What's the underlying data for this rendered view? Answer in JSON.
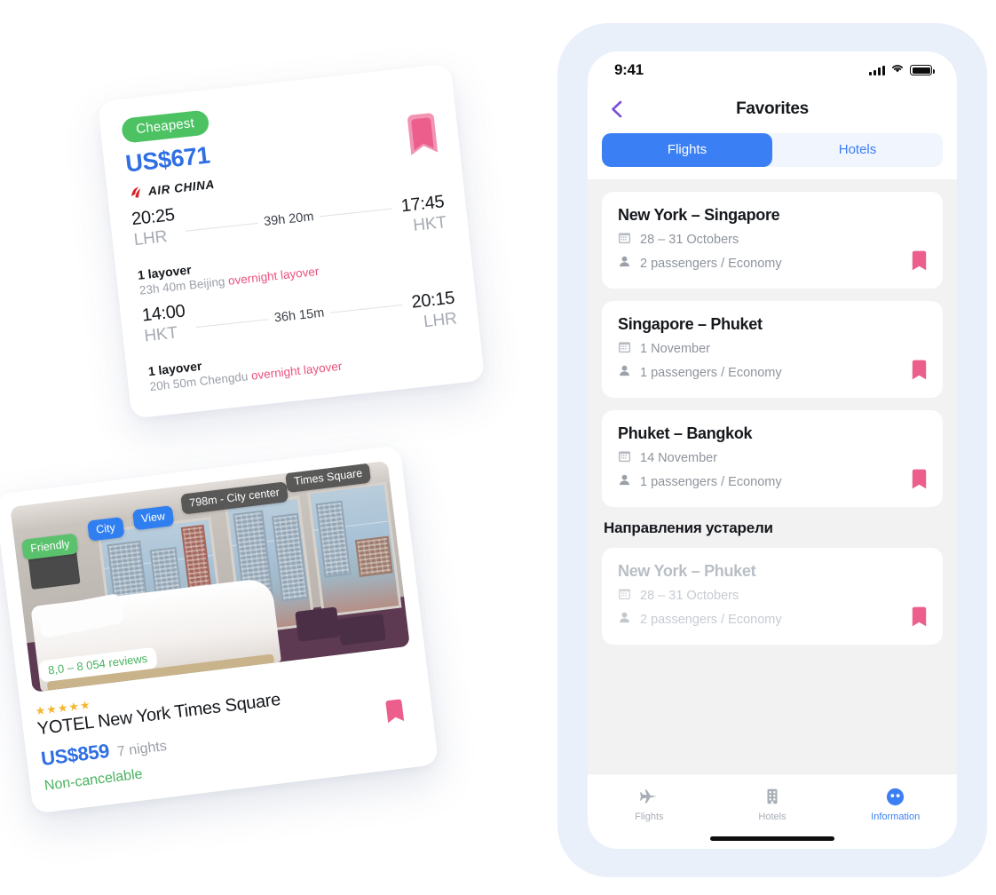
{
  "flight_card": {
    "badge": "Cheapest",
    "price": "US$671",
    "airline": "AIR CHINA",
    "legs": [
      {
        "depart_time": "20:25",
        "depart_code": "LHR",
        "duration": "39h 20m",
        "arrive_time": "17:45",
        "arrive_code": "HKT",
        "stops": "1 layover",
        "layover_detail": "23h 40m Beijing",
        "layover_note": "overnight layover"
      },
      {
        "depart_time": "14:00",
        "depart_code": "HKT",
        "duration": "36h 15m",
        "arrive_time": "20:15",
        "arrive_code": "LHR",
        "stops": "1 layover",
        "layover_detail": "20h 50m Chengdu",
        "layover_note": "overnight layover"
      }
    ]
  },
  "hotel_card": {
    "tags": [
      {
        "label": "Friendly",
        "style": "green"
      },
      {
        "label": "City",
        "style": "blue"
      },
      {
        "label": "View",
        "style": "blue"
      },
      {
        "label": "798m - City center",
        "style": "dark"
      },
      {
        "label": "Times Square",
        "style": "dark"
      }
    ],
    "reviews": "8,0 – 8 054 reviews",
    "stars": "★★★★★",
    "name": "YOTEL New York Times Square",
    "price": "US$859",
    "nights": "7 nights",
    "cancel_policy": "Non-cancelable"
  },
  "phone": {
    "status_bar": {
      "time": "9:41"
    },
    "title": "Favorites",
    "segmented": {
      "options": [
        {
          "label": "Flights",
          "active": true
        },
        {
          "label": "Hotels",
          "active": false
        }
      ]
    },
    "favorites": [
      {
        "route": "New York – Singapore",
        "dates": "28 – 31 Octobers",
        "passengers": "2 passengers / Economy"
      },
      {
        "route": "Singapore – Phuket",
        "dates": "1 November",
        "passengers": "1 passengers / Economy"
      },
      {
        "route": "Phuket – Bangkok",
        "dates": "14 November",
        "passengers": "1 passengers / Economy"
      }
    ],
    "expired_section": {
      "heading": "Направления устарели",
      "items": [
        {
          "route": "New York – Phuket",
          "dates": "28 – 31 Octobers",
          "passengers": "2 passengers / Economy"
        }
      ]
    },
    "tabbar": [
      {
        "label": "Flights",
        "icon": "plane-icon",
        "active": false
      },
      {
        "label": "Hotels",
        "icon": "building-icon",
        "active": false
      },
      {
        "label": "Information",
        "icon": "info-dots-icon",
        "active": true
      }
    ]
  },
  "colors": {
    "accent_blue": "#3b7ff5",
    "price_blue": "#2f6fe4",
    "green": "#4cc263",
    "pink": "#ef6c91",
    "overnight_pink": "#e8527e",
    "purple_back": "#7b4fd6",
    "phone_bezel": "#eaf0fa",
    "screen_bg": "#f2f2f2"
  }
}
